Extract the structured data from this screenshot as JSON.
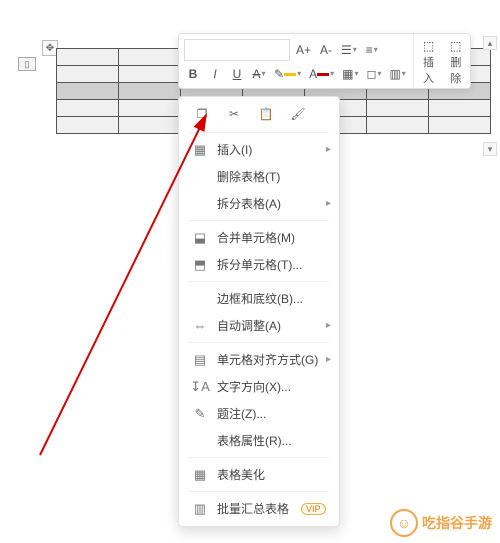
{
  "ruler_marker": "▯",
  "toolbar": {
    "font_name": "",
    "font_size_up": "A+",
    "font_size_down": "A-",
    "bold": "B",
    "italic": "I",
    "underline": "U",
    "strike": "A",
    "insert_label": "插入",
    "delete_label": "删除"
  },
  "quick_actions": {
    "copy": "复制",
    "cut": "剪切",
    "paste": "粘贴",
    "format_painter": "格式刷"
  },
  "menu": {
    "insert": "插入(I)",
    "delete_table": "删除表格(T)",
    "split_table": "拆分表格(A)",
    "merge_cells": "合并单元格(M)",
    "split_cells": "拆分单元格(T)...",
    "borders_shading": "边框和底纹(B)...",
    "autofit": "自动调整(A)",
    "cell_alignment": "单元格对齐方式(G)",
    "text_direction": "文字方向(X)...",
    "caption": "题注(Z)...",
    "table_props": "表格属性(R)...",
    "table_beautify": "表格美化",
    "batch_summary": "批量汇总表格",
    "vip": "VIP"
  },
  "watermark": "吃指谷手游"
}
